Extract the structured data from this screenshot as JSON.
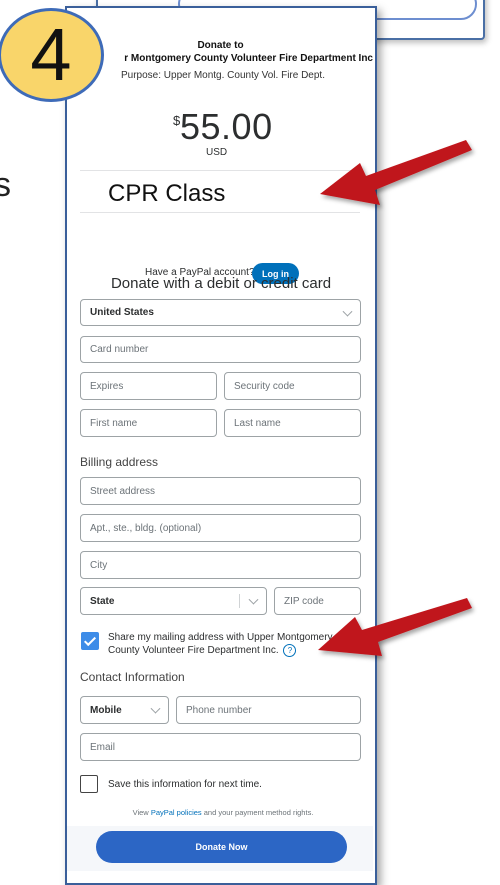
{
  "step_number": "4",
  "slide_edge_text": "s",
  "header": {
    "donate_to": "Donate to",
    "organization": "r Montgomery County Volunteer Fire Department Inc",
    "purpose": "Purpose: Upper Montg. County Vol. Fire Dept."
  },
  "amount": {
    "currency_symbol": "$",
    "value": "55.00",
    "currency_code": "USD"
  },
  "note": "CPR Class",
  "paypal": {
    "question": "Have a PayPal account?",
    "login_label": "Log in"
  },
  "card_form": {
    "heading": "Donate with a debit or credit card",
    "country": "United States",
    "card_number_placeholder": "Card number",
    "expires_placeholder": "Expires",
    "security_code_placeholder": "Security code",
    "first_name_placeholder": "First name",
    "last_name_placeholder": "Last name"
  },
  "billing": {
    "label": "Billing address",
    "street_placeholder": "Street address",
    "apt_placeholder": "Apt., ste., bldg. (optional)",
    "city_placeholder": "City",
    "state_value": "State",
    "zip_placeholder": "ZIP code"
  },
  "share": {
    "checked": true,
    "line1": "Share my mailing address with Upper Montgomery",
    "line2": "County Volunteer Fire Department Inc."
  },
  "contact": {
    "label": "Contact Information",
    "phone_type": "Mobile",
    "phone_placeholder": "Phone number",
    "email_placeholder": "Email"
  },
  "save_info": {
    "checked": false,
    "label": "Save this information for next time."
  },
  "policies": {
    "prefix": "View ",
    "link": "PayPal policies",
    "suffix": " and your payment method rights."
  },
  "donate_button_label": "Donate Now",
  "colors": {
    "paypal_blue": "#0070ba",
    "donate_button": "#2c66c5",
    "checkbox_blue": "#3d8ce8",
    "arrow_red": "#c0161c",
    "badge_yellow": "#f9d56a"
  }
}
